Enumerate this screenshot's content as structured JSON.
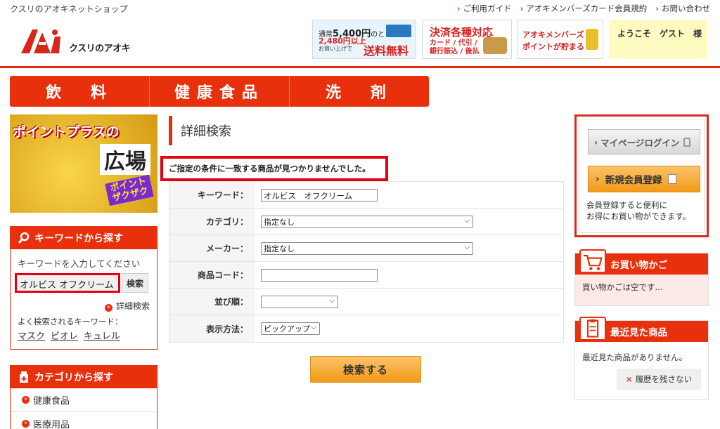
{
  "header": {
    "shop_name": "クスリのアオキネットショップ",
    "links": [
      "ご利用ガイド",
      "アオキメンバーズカード会員規約",
      "お問い合わせ"
    ],
    "logo_text": "クスリのアオキ",
    "banner_shipping": {
      "line1_prefix": "通常",
      "line1_amount": "5,400円",
      "line1_suffix": "のところ",
      "line2": "2,480円以上",
      "line2_sub": "お買い上げで",
      "line3": "送料無料"
    },
    "banner_payment": {
      "title": "決済各種対応",
      "line1": "カード / 代引 /",
      "line2": "銀行振込 / 後払"
    },
    "banner_points": {
      "line1": "アオキメンバーズ",
      "line2": "ポイントが貯まる"
    },
    "welcome": "ようこそ　ゲスト　様"
  },
  "global_nav": [
    "飲　料",
    "健康食品",
    "洗　剤"
  ],
  "point_banner": {
    "line1": "ポイントプラスの",
    "line2": "広場",
    "line3a": "ポイント",
    "line3b": "ザクザク"
  },
  "keyword_box": {
    "title": "キーワードから探す",
    "prompt": "キーワードを入力してください",
    "input_value": "オルビス オフクリーム",
    "search_label": "検索",
    "advanced_link": "詳細検索",
    "popular_label": "よく検索されるキーワード：",
    "popular": [
      "マスク",
      "ビオレ",
      "キュレル"
    ]
  },
  "category_box": {
    "title": "カテゴリから探す",
    "items": [
      "健康食品",
      "医療用品"
    ]
  },
  "main": {
    "title": "詳細検索",
    "not_found": "ご指定の条件に一致する商品が見つかりませんでした。",
    "form": {
      "keyword_label": "キーワード：",
      "keyword_value": "オルビス　オフクリーム",
      "category_label": "カテゴリ：",
      "category_value": "指定なし",
      "maker_label": "メーカー：",
      "maker_value": "指定なし",
      "code_label": "商品コード：",
      "code_value": "",
      "sort_label": "並び順：",
      "sort_value": "",
      "display_label": "表示方法：",
      "display_value": "ピックアップ"
    },
    "search_button": "検索する"
  },
  "sidebar": {
    "mypage_button": "マイページログイン",
    "register_button": "新規会員登録",
    "register_note_line1": "会員登録すると便利に",
    "register_note_line2": "お得にお買い物ができます。",
    "cart_title": "お買い物かご",
    "cart_empty": "買い物かごは空です...",
    "recent_title": "最近見た商品",
    "recent_empty": "最近見た商品がありません。",
    "clear_history": "履歴を残さない"
  },
  "colors": {
    "brand_red": "#e8300c",
    "highlight_red": "#e3000f",
    "orange_button": "#f29a18",
    "welcome_bg": "#fdfbc0"
  }
}
